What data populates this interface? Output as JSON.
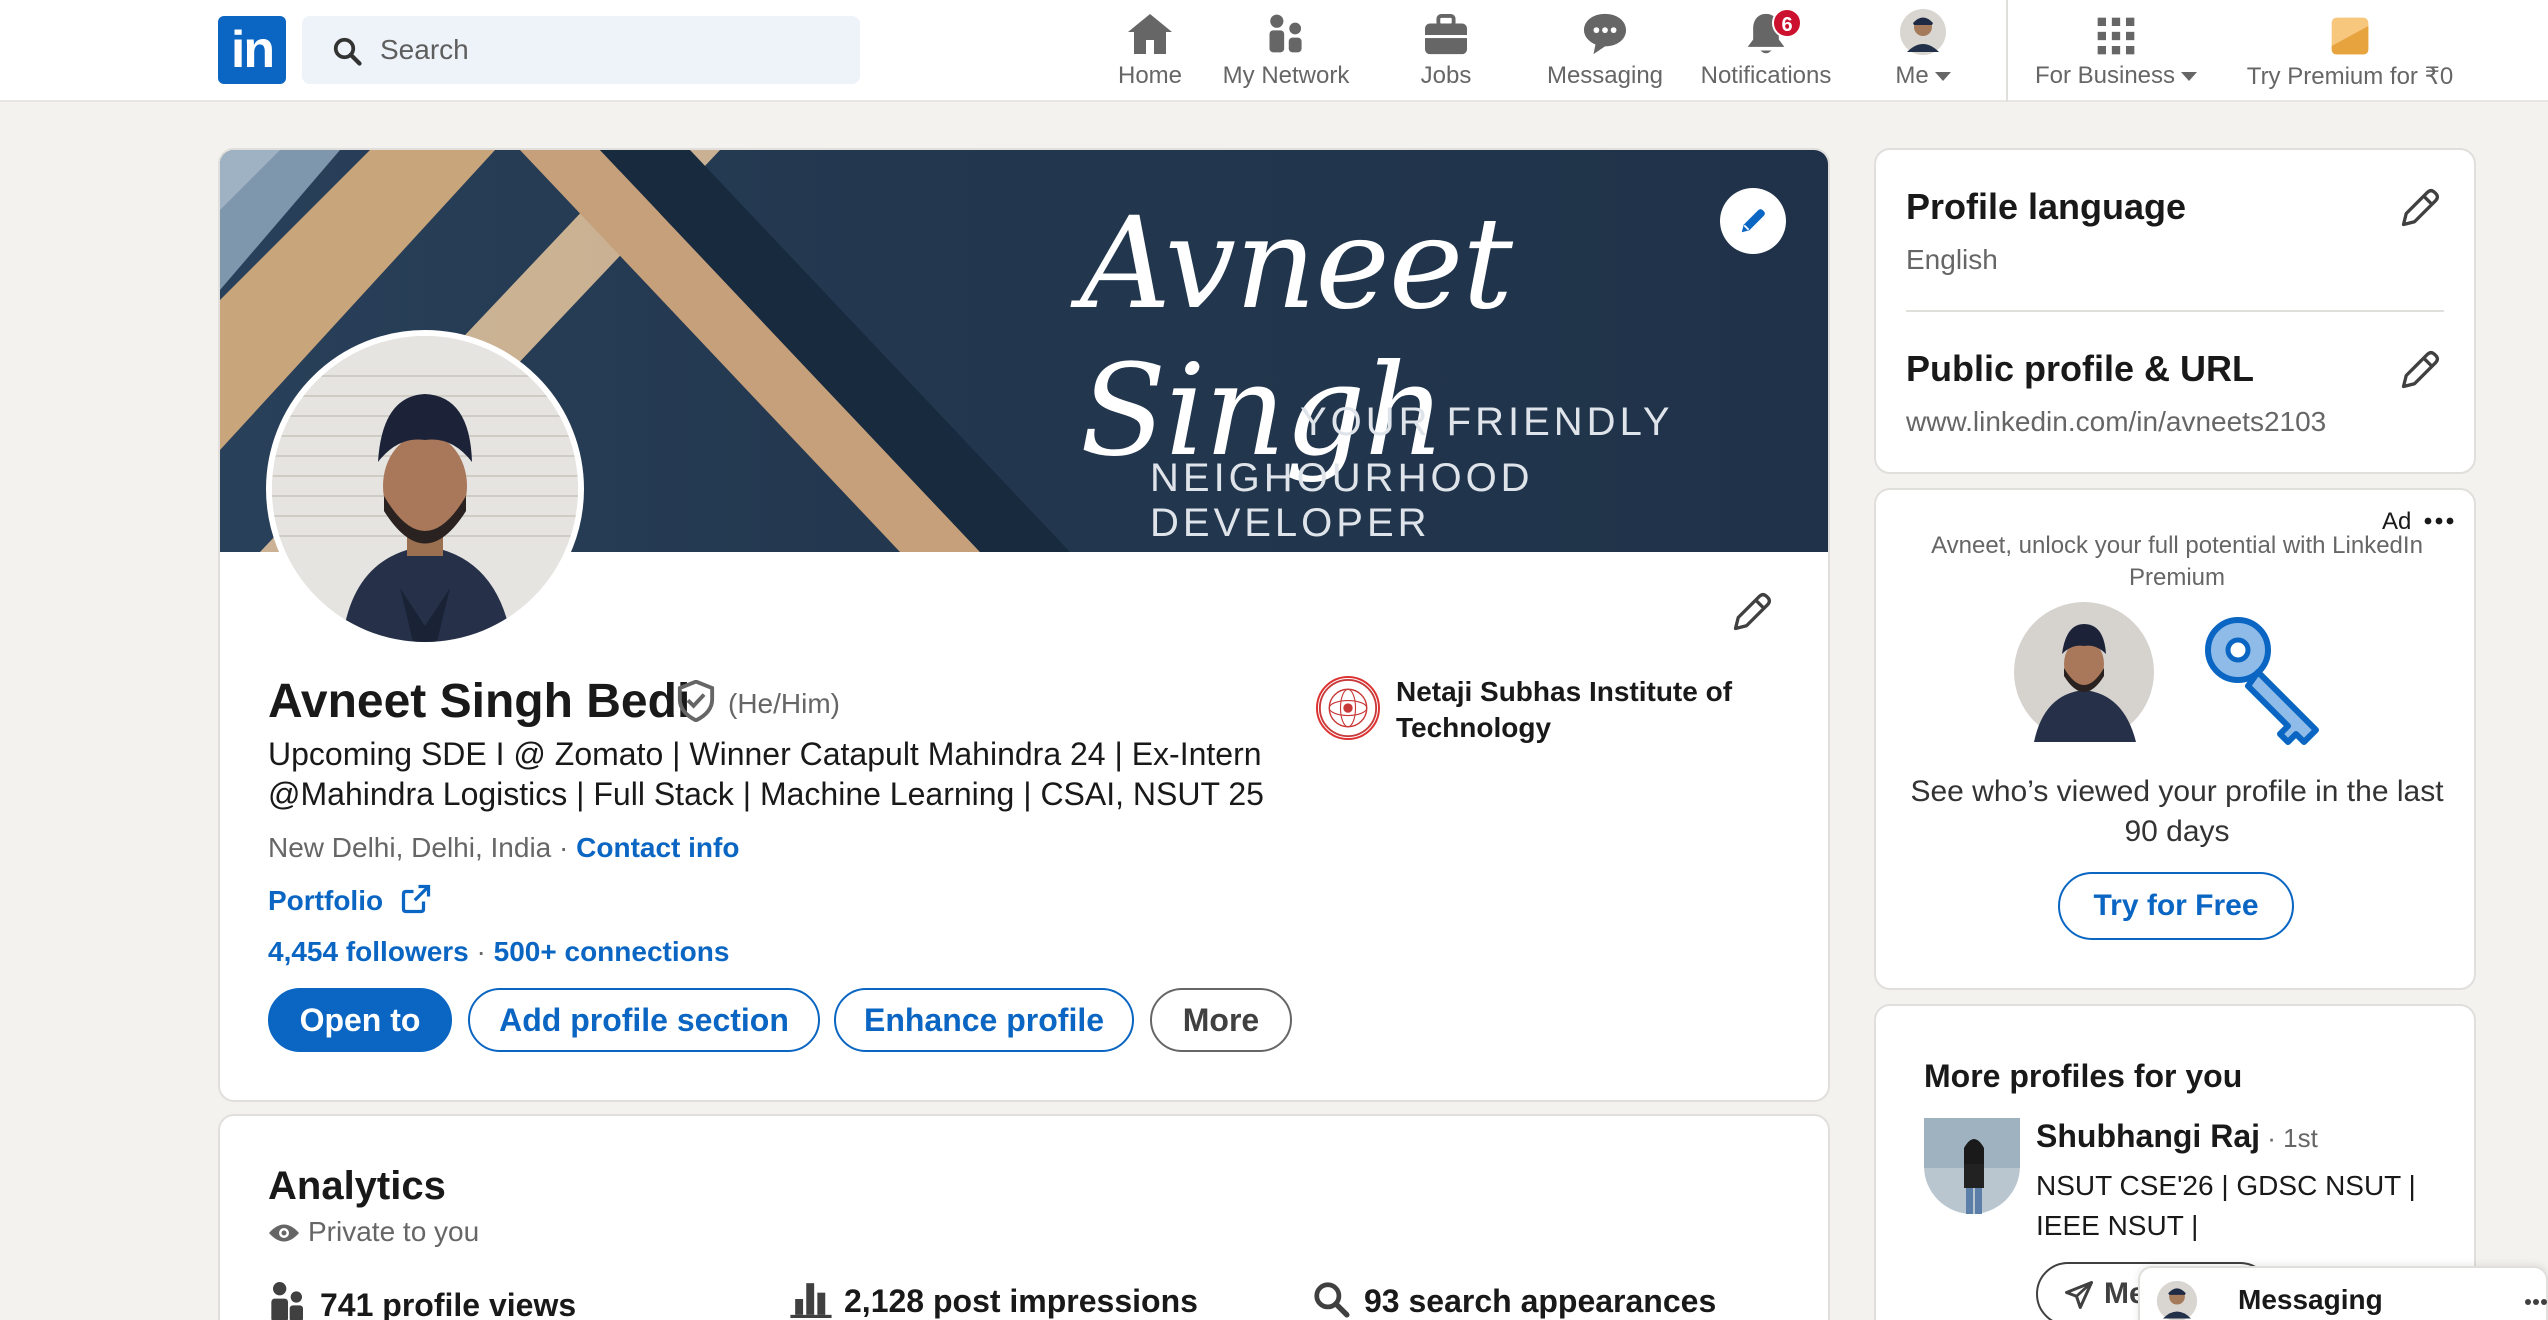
{
  "nav": {
    "logo": "in",
    "search_placeholder": "Search",
    "items": [
      {
        "label": "Home",
        "icon": "home-icon"
      },
      {
        "label": "My Network",
        "icon": "network-icon"
      },
      {
        "label": "Jobs",
        "icon": "briefcase-icon"
      },
      {
        "label": "Messaging",
        "icon": "chat-icon"
      },
      {
        "label": "Notifications",
        "icon": "bell-icon",
        "badge": "6"
      },
      {
        "label": "Me",
        "icon": "avatar"
      }
    ],
    "business": "For Business",
    "premium": "Try Premium for ₹0"
  },
  "profile": {
    "banner": {
      "signature": "Avneet Singh",
      "tagline_1": "YOUR FRIENDLY",
      "tagline_2": "NEIGHOURHOOD DEVELOPER"
    },
    "name": "Avneet Singh Bedi",
    "pronouns": "(He/Him)",
    "headline": "Upcoming SDE I @ Zomato | Winner Catapult Mahindra 24 | Ex-Intern @Mahindra Logistics | Full Stack | Machine Learning | CSAI, NSUT 25",
    "location": "New Delhi, Delhi, India",
    "separator": " · ",
    "contact_info": "Contact info",
    "portfolio": "Portfolio",
    "followers": "4,454 followers",
    "connections": "500+ connections",
    "school": "Netaji Subhas Institute of Technology",
    "buttons": {
      "open_to": "Open to",
      "add_section": "Add profile section",
      "enhance": "Enhance profile",
      "more": "More"
    }
  },
  "analytics": {
    "title": "Analytics",
    "subtitle": "Private to you",
    "items": [
      {
        "label": "741 profile views",
        "icon": "people-icon"
      },
      {
        "label": "2,128 post impressions",
        "icon": "bar-chart-icon"
      },
      {
        "label": "93 search appearances",
        "icon": "search-icon"
      }
    ]
  },
  "sidebar": {
    "language": {
      "title": "Profile language",
      "value": "English"
    },
    "public_url": {
      "title": "Public profile & URL",
      "value": "www.linkedin.com/in/avneets2103"
    },
    "ad": {
      "label": "Ad",
      "text": "Avneet, unlock your full potential with LinkedIn Premium",
      "headline": "See who’s viewed your profile in the last 90 days",
      "cta": "Try for Free"
    },
    "more_profiles": {
      "title": "More profiles for you",
      "people": [
        {
          "name": "Shubhangi Raj",
          "degree": " · 1st",
          "headline": "NSUT CSE'26 | GDSC NSUT | IEEE NSUT |",
          "button": "Me"
        }
      ]
    }
  },
  "messaging": {
    "label": "Messaging"
  },
  "colors": {
    "brand": "#0a66c2",
    "badge": "#cb112d",
    "background": "#f4f2ee"
  }
}
